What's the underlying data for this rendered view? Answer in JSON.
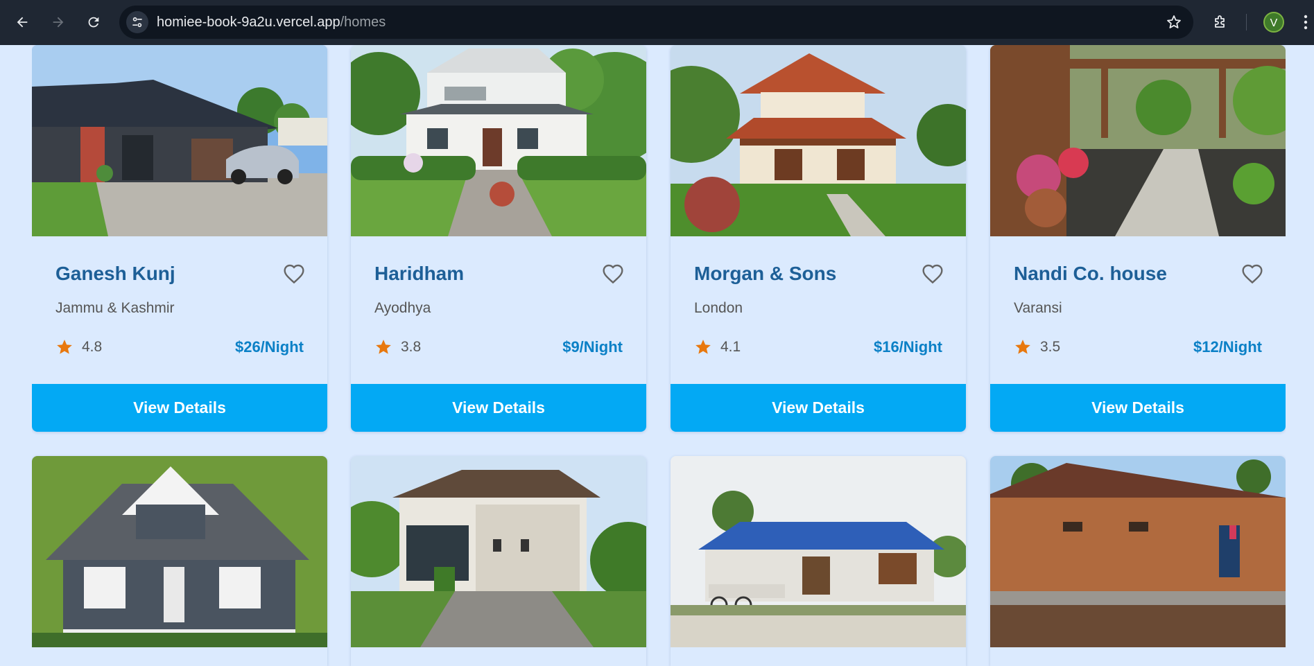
{
  "browser": {
    "url_domain": "homiee-book-9a2u.vercel.app",
    "url_path": "/homes",
    "profile_initial": "V"
  },
  "colors": {
    "page_bg": "#dbeafe",
    "title": "#1d5f97",
    "price": "#0b80c6",
    "button": "#03a9f4",
    "star": "#e8780e"
  },
  "homes": [
    {
      "name": "Ganesh Kunj",
      "location": "Jammu & Kashmir",
      "rating": "4.8",
      "price": "$26/Night",
      "button_label": "View Details"
    },
    {
      "name": "Haridham",
      "location": "Ayodhya",
      "rating": "3.8",
      "price": "$9/Night",
      "button_label": "View Details"
    },
    {
      "name": "Morgan & Sons",
      "location": "London",
      "rating": "4.1",
      "price": "$16/Night",
      "button_label": "View Details"
    },
    {
      "name": "Nandi Co. house",
      "location": "Varansi",
      "rating": "3.5",
      "price": "$12/Night",
      "button_label": "View Details"
    }
  ],
  "icons": {
    "back": "arrow-left-icon",
    "forward": "arrow-right-icon",
    "reload": "reload-icon",
    "site_info": "tune-icon",
    "bookmark": "star-outline-icon",
    "extensions": "puzzle-icon",
    "menu": "kebab-icon",
    "favorite": "heart-outline-icon",
    "rating": "star-filled-icon"
  }
}
